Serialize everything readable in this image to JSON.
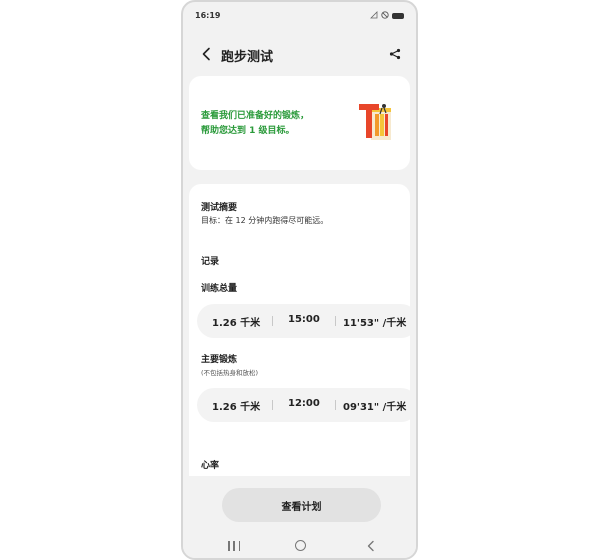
{
  "status_bar": {
    "time": "16:19",
    "signal_icon": "signal-icon",
    "dnd_icon": "do-not-disturb-icon",
    "battery_icon": "battery-icon"
  },
  "header": {
    "title": "跑步测试",
    "back_icon": "chevron-left-icon",
    "share_icon": "share-icon"
  },
  "promo": {
    "line1": "查看我们已准备好的锻炼，",
    "line2": "帮助您达到 1 级目标。",
    "accent_color": "#2a9a3a"
  },
  "summary": {
    "title": "测试摘要",
    "goal": "目标：在 12 分钟内跑得尽可能远。"
  },
  "records": {
    "title": "记录",
    "total": {
      "title": "训练总量",
      "distance": "1.26 千米",
      "duration": "15:00",
      "pace": "11'53\" /千米"
    },
    "main": {
      "title": "主要锻炼",
      "note": "(不包括热身和放松)",
      "distance": "1.26 千米",
      "duration": "12:00",
      "pace": "09'31\" /千米"
    }
  },
  "heart_rate": {
    "title": "心率"
  },
  "actions": {
    "view_plan": "查看计划"
  },
  "nav": {
    "recents_icon": "recents-icon",
    "home_icon": "home-icon",
    "back_icon": "back-icon"
  }
}
